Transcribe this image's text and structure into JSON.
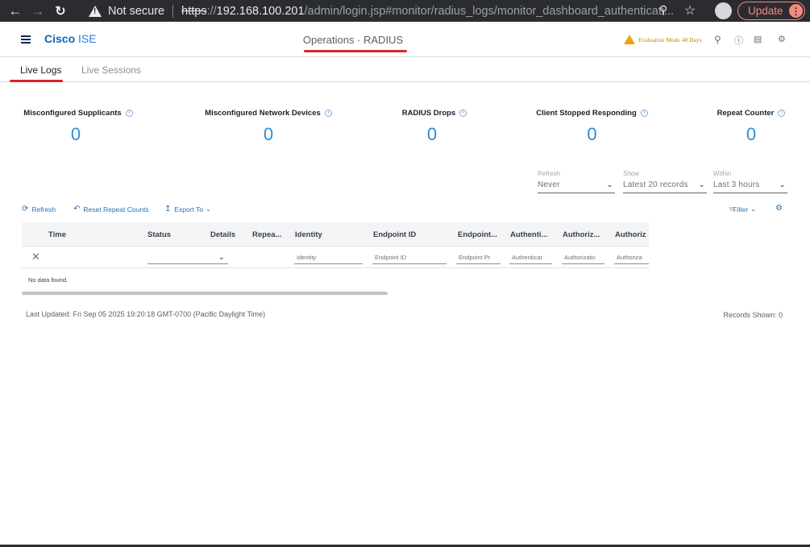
{
  "browser": {
    "security": "Not secure",
    "url_scheme": "https",
    "url_sep": "://",
    "url_host": "192.168.100.201",
    "url_path": "/admin/login.jsp#monitor/radius_logs/monitor_dashboard_authenticati...",
    "update_label": "Update"
  },
  "header": {
    "brand_bold": "Cisco",
    "brand_light": "ISE",
    "title": "Operations · RADIUS",
    "evaluation": "Evaluation Mode 48 Days"
  },
  "tabs": [
    {
      "label": "Live Logs",
      "active": true
    },
    {
      "label": "Live Sessions",
      "active": false
    }
  ],
  "dashlets": [
    {
      "label": "Misconfigured Supplicants",
      "value": "0"
    },
    {
      "label": "Misconfigured Network Devices",
      "value": "0"
    },
    {
      "label": "RADIUS Drops",
      "value": "0"
    },
    {
      "label": "Client Stopped Responding",
      "value": "0"
    },
    {
      "label": "Repeat Counter",
      "value": "0"
    }
  ],
  "filters": {
    "refresh": {
      "label": "Refresh",
      "value": "Never"
    },
    "show": {
      "label": "Show",
      "value": "Latest 20 records"
    },
    "within": {
      "label": "Within",
      "value": "Last 3 hours"
    }
  },
  "toolbar": {
    "refresh": "Refresh",
    "reset": "Reset Repeat Counts",
    "export": "Export To",
    "filter": "Filter"
  },
  "table": {
    "columns": [
      "Time",
      "Status",
      "Details",
      "Repea...",
      "Identity",
      "Endpoint ID",
      "Endpoint...",
      "Authenti...",
      "Authoriz...",
      "Authoriz"
    ],
    "filter_placeholders": {
      "identity": "Identity",
      "endpoint_id": "Endpoint ID",
      "endpoint_profile": "Endpoint Pr",
      "authentication": "Authenticat",
      "authorization_policy": "Authorizatic",
      "authorization_profile": "Authoriza"
    },
    "empty_message": "No data found."
  },
  "footer": {
    "last_updated": "Last Updated: Fri Sep 05 2025 19:20:18 GMT-0700 (Pacific Daylight Time)",
    "records_shown": "Records Shown: 0"
  }
}
